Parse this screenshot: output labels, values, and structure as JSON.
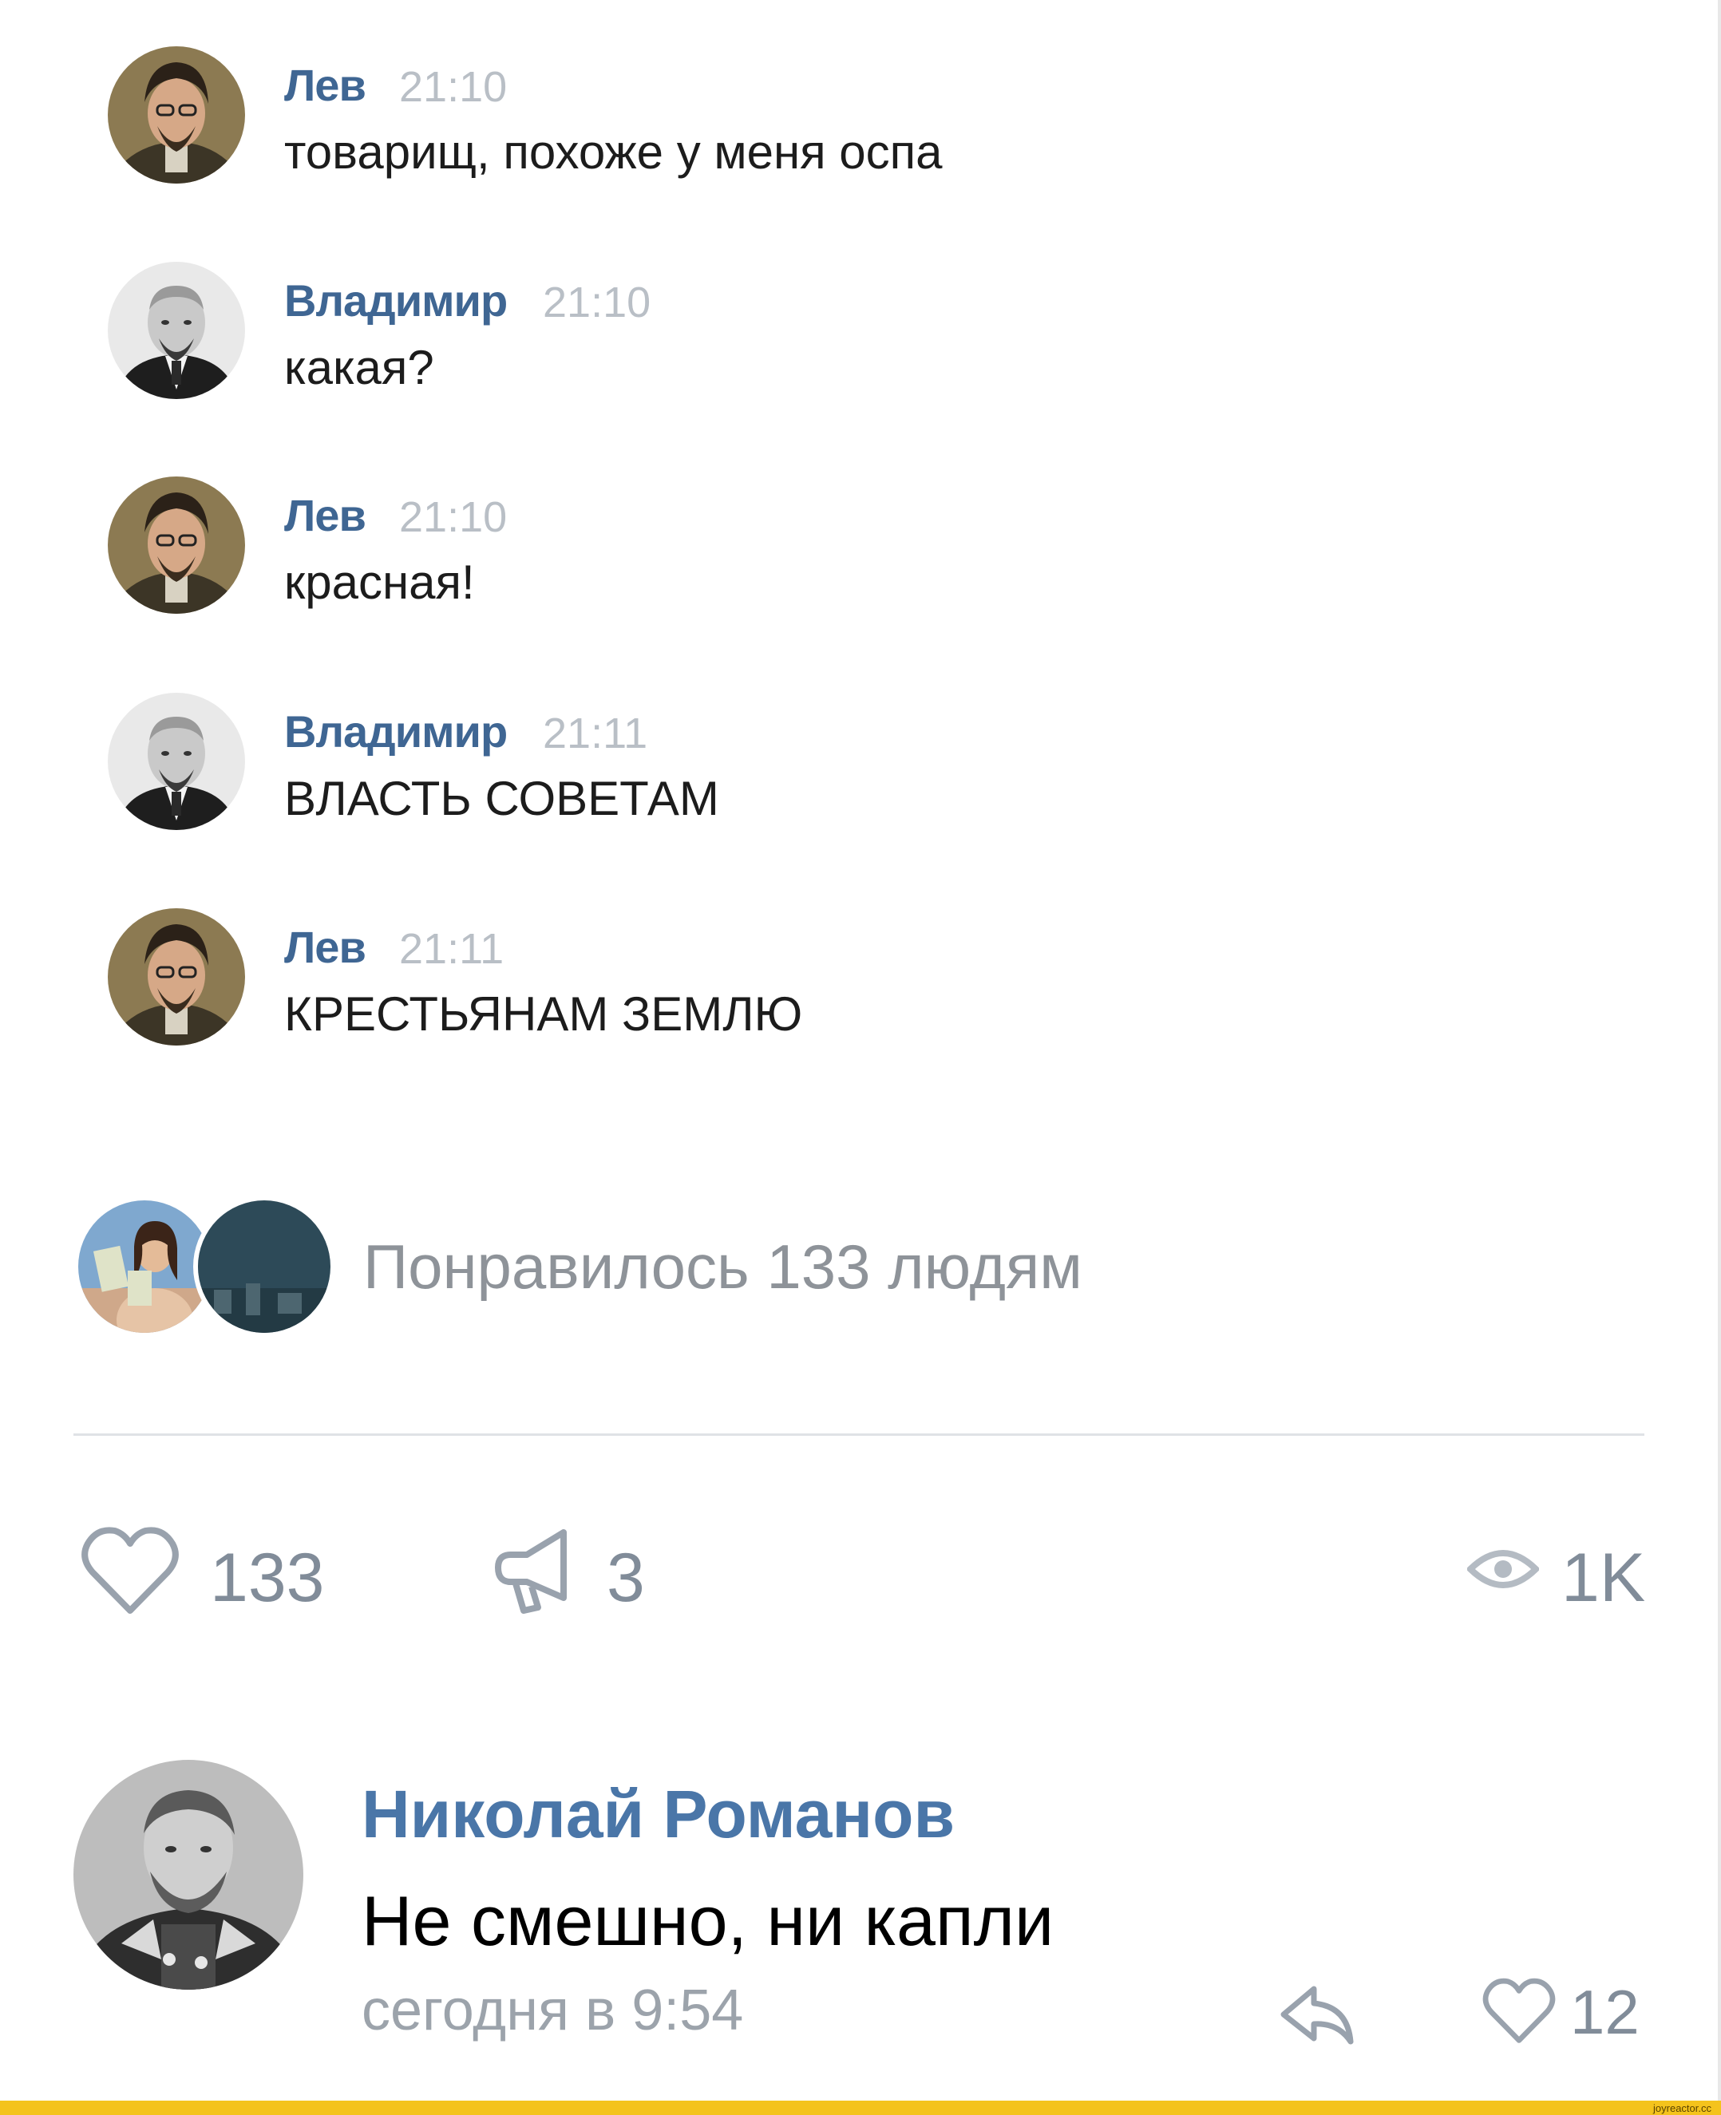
{
  "messages": [
    {
      "author": "Лев",
      "time": "21:10",
      "text": "товарищ, похоже у меня оспа",
      "avatar_icon": "lev-portrait"
    },
    {
      "author": "Владимир",
      "time": "21:10",
      "text": "какая?",
      "avatar_icon": "vladimir-portrait"
    },
    {
      "author": "Лев",
      "time": "21:10",
      "text": "красная!",
      "avatar_icon": "lev-portrait"
    },
    {
      "author": "Владимир",
      "time": "21:11",
      "text": "ВЛАСТЬ СОВЕТАМ",
      "avatar_icon": "vladimir-portrait"
    },
    {
      "author": "Лев",
      "time": "21:11",
      "text": "КРЕСТЬЯНАМ ЗЕМЛЮ",
      "avatar_icon": "lev-portrait"
    }
  ],
  "liked": {
    "text": "Понравилось 133 людям"
  },
  "actions": {
    "likes": "133",
    "shares": "3",
    "views": "1K"
  },
  "comment": {
    "author": "Николай Романов",
    "text": "Не смешно, ни капли",
    "date": "сегодня в 9:54",
    "likes": "12"
  },
  "watermark": "joyreactor.cc",
  "colors": {
    "name_blue": "#3f6693",
    "comment_name_blue": "#4a76a8",
    "muted_gray": "#818c99",
    "watermark_yellow": "#f4c31c"
  }
}
